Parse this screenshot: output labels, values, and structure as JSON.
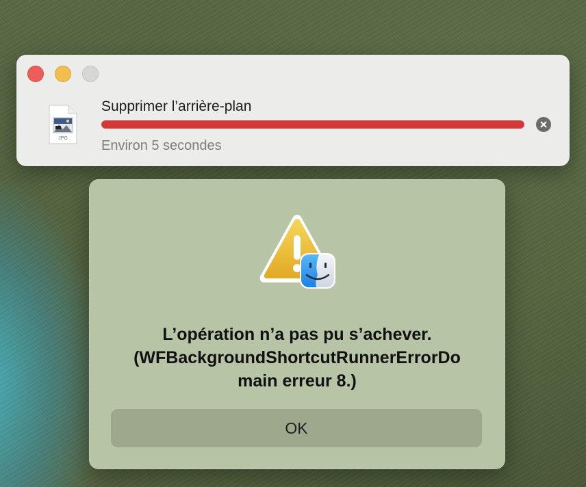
{
  "progress_window": {
    "task_title": "Supprimer l’arrière-plan",
    "status_text": "Environ 5 secondes",
    "progress_fraction": 1.0,
    "progress_color": "#d13a37",
    "file_type_label": "JPG",
    "icons": {
      "close": "close-traffic-light",
      "minimize": "minimize-traffic-light",
      "zoom": "zoom-traffic-light",
      "file": "jpg-file-icon",
      "cancel": "cancel-x-icon"
    }
  },
  "alert": {
    "message_line1": "L’opération n’a pas pu s’achever.",
    "message_line2": "(WFBackgroundShortcutRunnerErrorDo",
    "message_line3": "main erreur 8.)",
    "ok_label": "OK",
    "icons": {
      "warning": "warning-triangle-icon",
      "badge": "finder-icon"
    }
  }
}
